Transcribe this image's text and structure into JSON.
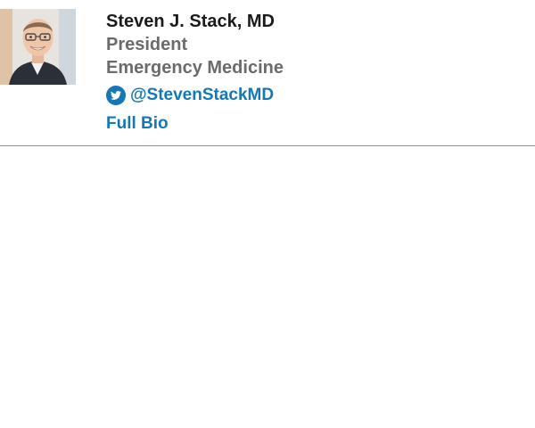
{
  "profile": {
    "name": "Steven J. Stack, MD",
    "title": "President",
    "specialty": "Emergency Medicine",
    "twitter_handle": "@StevenStackMD",
    "full_bio_label": "Full Bio",
    "photo_alt": "Steven J. Stack, MD"
  },
  "icons": {
    "twitter": "twitter-icon",
    "photo": "avatar"
  },
  "colors": {
    "name_text": "#1b1b1b",
    "secondary_text": "#6b6b6b",
    "link": "#1478b4",
    "divider": "#8c8c8c"
  }
}
